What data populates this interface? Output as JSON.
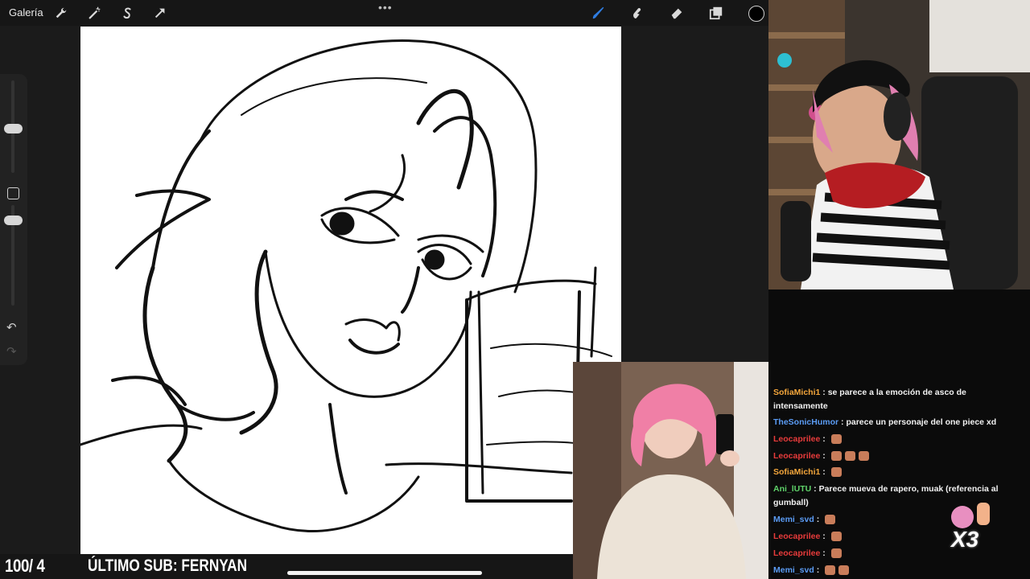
{
  "toolbar": {
    "gallery_label": "Galería",
    "left_tools": [
      "wrench-icon",
      "magic-wand-icon",
      "selection-s-icon",
      "transform-arrow-icon"
    ],
    "right_tools": [
      "brush-icon",
      "smudge-icon",
      "eraser-icon",
      "layers-icon"
    ],
    "more_label": "•••",
    "active_color": "#000000",
    "active_tool_color": "#2f7de1"
  },
  "sidebar": {
    "undo_label": "↶",
    "redo_label": "↷"
  },
  "chat": {
    "messages": [
      {
        "user": "SofiaMichi1",
        "color": "#f4a63b",
        "text": "se parece a la emoción de asco de intensamente",
        "emotes": 0
      },
      {
        "user": "TheSonicHumor",
        "color": "#5b9cf5",
        "text": "parece un personaje del one piece xd",
        "emotes": 0
      },
      {
        "user": "Leocaprilee",
        "color": "#e83b3b",
        "text": "",
        "emotes": 1
      },
      {
        "user": "Leocaprilee",
        "color": "#e83b3b",
        "text": "",
        "emotes": 3
      },
      {
        "user": "SofiaMichi1",
        "color": "#f4a63b",
        "text": "",
        "emotes": 1
      },
      {
        "user": "Ani_lUTU",
        "color": "#5fd36a",
        "text": "Parece mueva de rapero, muak (referencia al gumball)",
        "emotes": 0
      },
      {
        "user": "Memi_svd",
        "color": "#5b9cf5",
        "text": "",
        "emotes": 1
      },
      {
        "user": "Leocaprilee",
        "color": "#e83b3b",
        "text": "",
        "emotes": 1
      },
      {
        "user": "Leocaprilee",
        "color": "#e83b3b",
        "text": "",
        "emotes": 1
      },
      {
        "user": "Memi_svd",
        "color": "#5b9cf5",
        "text": "",
        "emotes": 2
      }
    ]
  },
  "overlay": {
    "sub_counter": "100/ 4",
    "last_sub": "ÚLTIMO SUB: FERNYAN",
    "combo_label": "X3"
  }
}
